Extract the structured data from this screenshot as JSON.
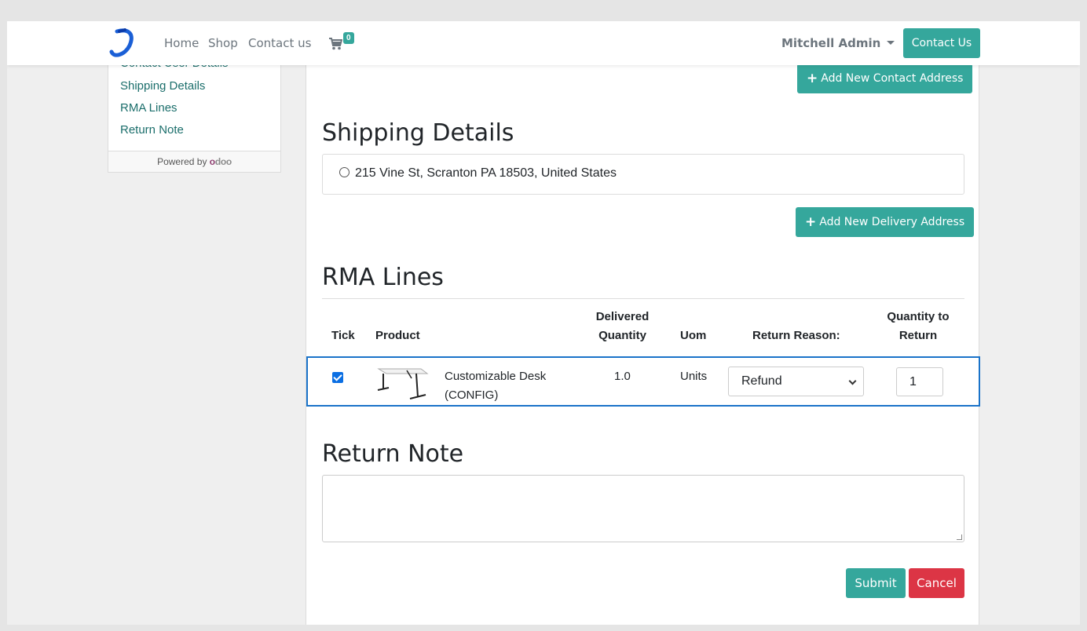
{
  "navbar": {
    "links": [
      "Home",
      "Shop",
      "Contact us"
    ],
    "cart_count": "0",
    "user_name": "Mitchell Admin",
    "contact_button": "Contact Us"
  },
  "sidebar": {
    "items": [
      {
        "label": "Contact User Details"
      },
      {
        "label": "Shipping Details"
      },
      {
        "label": "RMA Lines"
      },
      {
        "label": "Return Note"
      }
    ],
    "powered_by": "Powered by",
    "brand": "odoo"
  },
  "main": {
    "add_contact_address": "Add New Contact Address",
    "shipping_title": "Shipping Details",
    "address": "215 Vine St, Scranton PA 18503, United States",
    "add_delivery_address": "Add New Delivery Address",
    "rma_title": "RMA Lines",
    "table": {
      "headers": {
        "tick": "Tick",
        "product": "Product",
        "delivered_quantity": "Delivered Quantity",
        "uom": "Uom",
        "return_reason": "Return Reason:",
        "quantity_to_return": "Quantity to Return"
      },
      "rows": [
        {
          "checked": true,
          "product_line1": "Customizable Desk",
          "product_line2": "(CONFIG)",
          "delivered": "1.0",
          "uom": "Units",
          "return_reason": "Refund",
          "quantity": "1"
        }
      ]
    },
    "return_note_title": "Return Note",
    "return_note_value": "",
    "submit": "Submit",
    "cancel": "Cancel"
  },
  "colors": {
    "accent": "#35a79c",
    "link": "#1b6e6b",
    "danger": "#dc3545",
    "highlight_border": "#1a73c9"
  }
}
